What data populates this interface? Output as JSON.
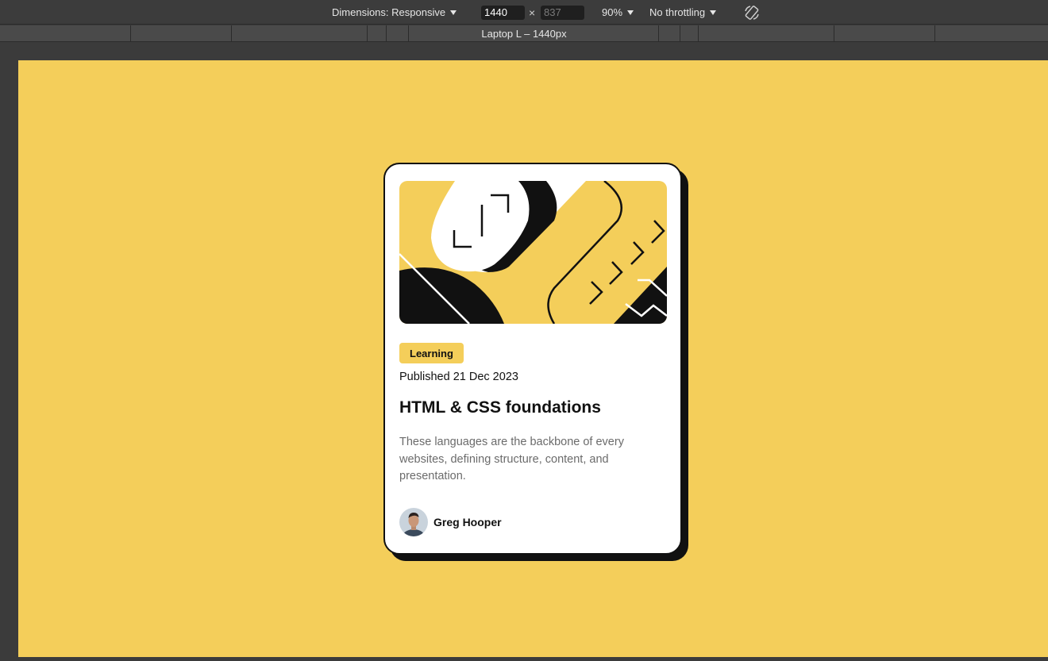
{
  "devtools": {
    "dimensions_label": "Dimensions: Responsive",
    "width_value": "1440",
    "height_placeholder": "837",
    "times_glyph": "×",
    "zoom_label": "90%",
    "throttling_label": "No throttling",
    "breakpoint_label": "Laptop L – 1440px"
  },
  "page": {
    "background_color": "#f4ce5a",
    "card": {
      "tag": "Learning",
      "published": "Published 21 Dec 2023",
      "title": "HTML & CSS foundations",
      "description": "These languages are the backbone of every websites, defining structure, content, and presentation.",
      "author_name": "Greg Hooper"
    }
  },
  "colors": {
    "accent_yellow": "#f4ce5a",
    "text_dark": "#111111",
    "text_muted": "#6b6b6b"
  }
}
